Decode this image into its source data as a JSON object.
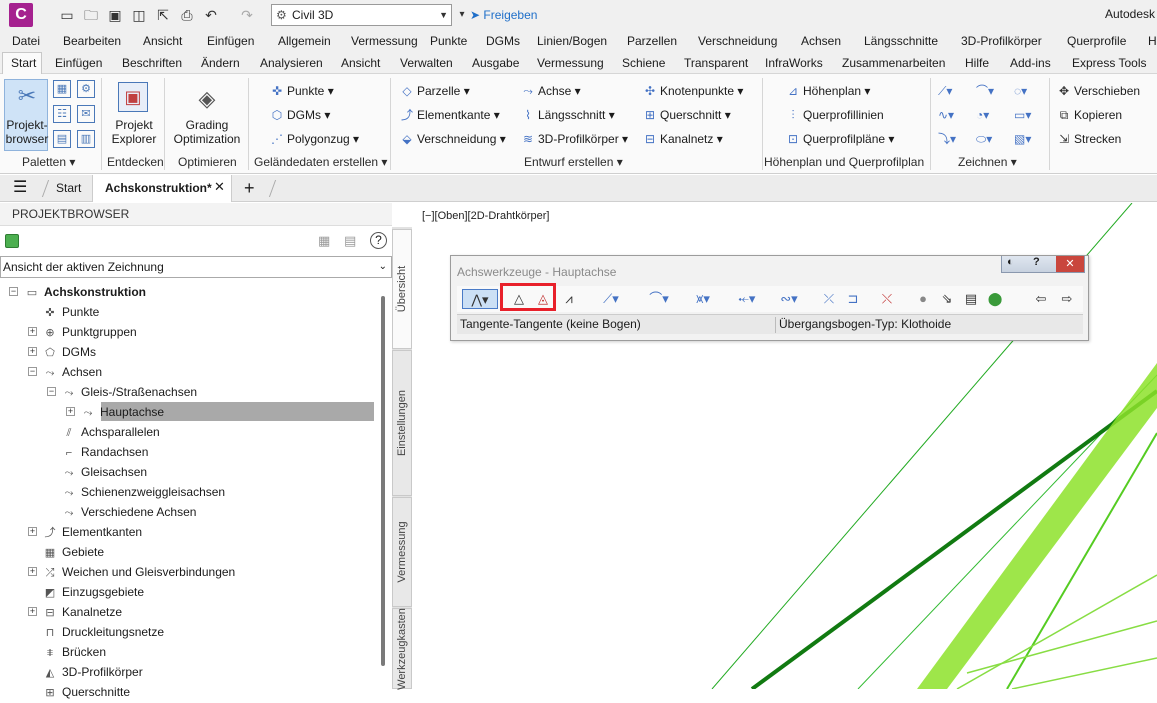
{
  "app": {
    "logo_letter": "C",
    "workspace": "Civil 3D",
    "share_label": "Freigeben",
    "brand": "Autodesk"
  },
  "menu": [
    "Datei",
    "Bearbeiten",
    "Ansicht",
    "Einfügen",
    "Allgemein",
    "Vermessung",
    "Punkte",
    "DGMs",
    "Linien/Bogen",
    "Parzellen",
    "Verschneidung",
    "Achsen",
    "Längsschnitte",
    "3D-Profilkörper",
    "Querprofile",
    "H"
  ],
  "ribbon_tabs": [
    "Start",
    "Einfügen",
    "Beschriften",
    "Ändern",
    "Analysieren",
    "Ansicht",
    "Verwalten",
    "Ausgabe",
    "Vermessung",
    "Schiene",
    "Transparent",
    "InfraWorks",
    "Zusammenarbeiten",
    "Hilfe",
    "Add-ins",
    "Express Tools"
  ],
  "ribbon": {
    "project_browser": "Projekt-\nbrowser",
    "project_explorer": "Projekt\nExplorer",
    "grading_opt": "Grading\nOptimization",
    "panels": {
      "paletten": "Paletten ▾",
      "entdecken": "Entdecken",
      "optimieren": "Optimieren",
      "gelaende": "Geländedaten erstellen ▾",
      "entwurf": "Entwurf erstellen ▾",
      "hoehenplan": "Höhenplan und Querprofilplan",
      "zeichnen": "Zeichnen ▾"
    },
    "gelaende": [
      "Punkte ▾",
      "DGMs ▾",
      "Polygonzug ▾"
    ],
    "entwurf_c1": [
      "Parzelle ▾",
      "Elementkante ▾",
      "Verschneidung ▾"
    ],
    "entwurf_c2": [
      "Achse ▾",
      "Längsschnitt ▾",
      "3D-Profilkörper ▾"
    ],
    "entwurf_c3": [
      "Knotenpunkte ▾",
      "Querschnitt ▾",
      "Kanalnetz ▾"
    ],
    "hoehenplan": [
      "Höhenplan ▾",
      "Querprofillinien",
      "Querprofilpläne ▾"
    ],
    "modify": [
      "Verschieben",
      "Kopieren",
      "Strecken"
    ]
  },
  "doc_tabs": {
    "start": "Start",
    "active": "Achskonstruktion*"
  },
  "browser": {
    "header": "PROJEKTBROWSER",
    "view_select": "Ansicht der aktiven Zeichnung",
    "nodes": [
      "Achskonstruktion",
      "Punkte",
      "Punktgruppen",
      "DGMs",
      "Achsen",
      "Gleis-/Straßenachsen",
      "Hauptachse",
      "Achsparallelen",
      "Randachsen",
      "Gleisachsen",
      "Schienenzweiggleisachsen",
      "Verschiedene Achsen",
      "Elementkanten",
      "Gebiete",
      "Weichen und Gleisverbindungen",
      "Einzugsgebiete",
      "Kanalnetze",
      "Druckleitungsnetze",
      "Brücken",
      "3D-Profilkörper",
      "Querschnitte"
    ]
  },
  "side_tabs": [
    "Übersicht",
    "Einstellungen",
    "Vermessung",
    "Werkzeugkasten"
  ],
  "viewport": {
    "label": "[−][Oben][2D-Drahtkörper]"
  },
  "palette": {
    "title": "Achswerkzeuge - Hauptachse",
    "status_left": "Tangente-Tangente (keine Bogen)",
    "status_right": "Übergangsbogen-Typ: Klothoide"
  },
  "colors": {
    "accent": "#a5218f",
    "highlight": "#e8202a",
    "green": "#1f9e1f"
  }
}
